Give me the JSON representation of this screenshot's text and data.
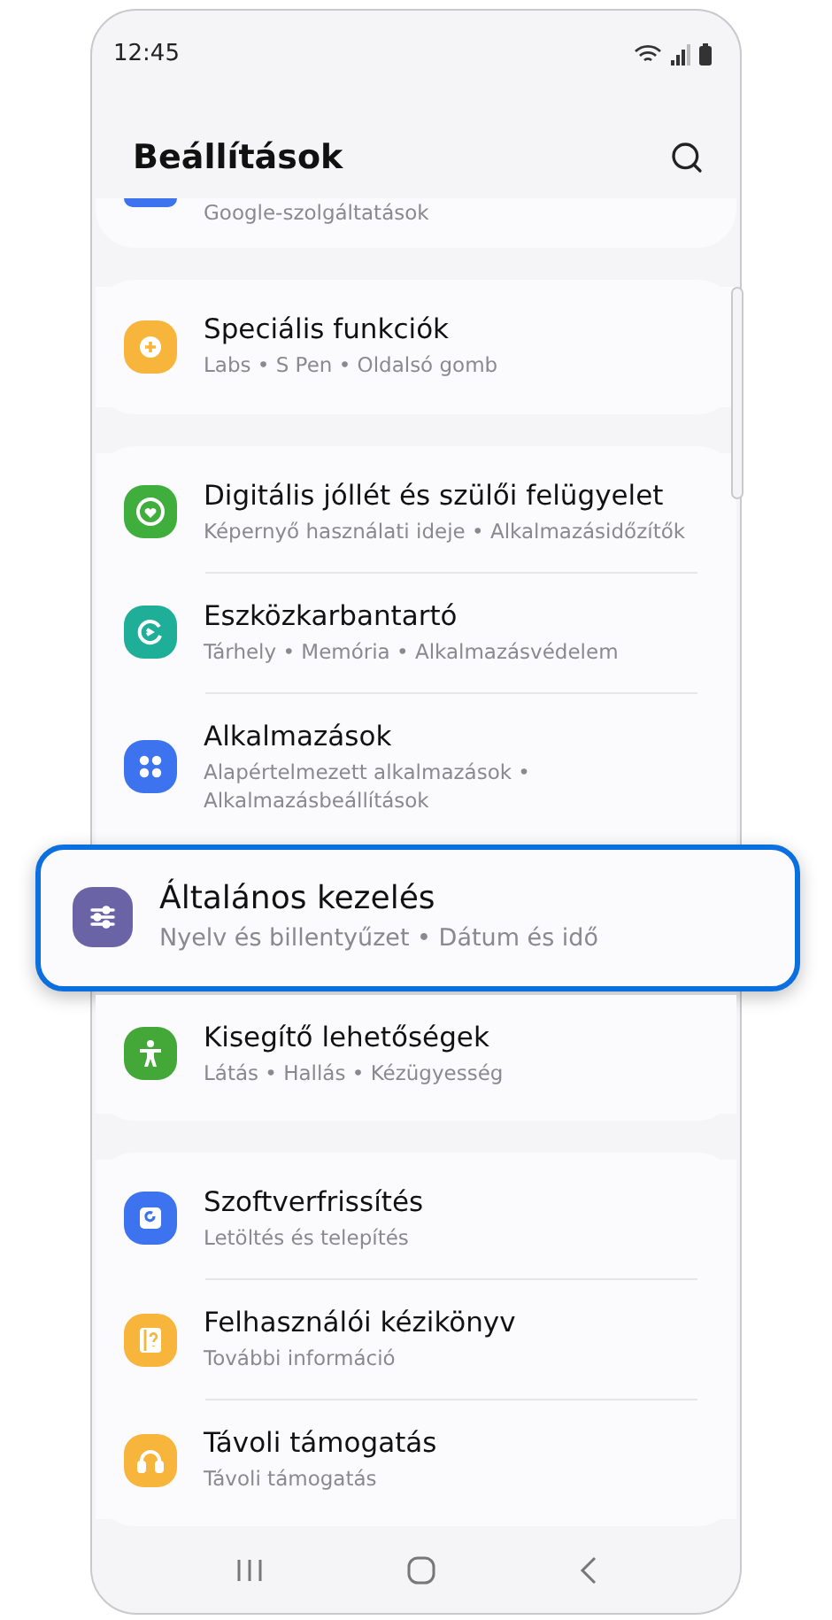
{
  "status_bar": {
    "time": "12:45"
  },
  "header": {
    "title": "Beállítások"
  },
  "groups": [
    {
      "partial": true,
      "items": [
        {
          "subtitle": "Google-szolgáltatások",
          "color": "#3d73ee"
        }
      ]
    },
    {
      "partial": false,
      "items": [
        {
          "title": "Speciális funkciók",
          "subtitle": "Labs  •  S Pen  •  Oldalsó gomb",
          "color": "#f8b53c"
        }
      ]
    },
    {
      "partial": false,
      "items": [
        {
          "title": "Digitális jóllét és szülői felügyelet",
          "subtitle": "Képernyő használati ideje  •  Alkalmazásidőzítők",
          "color": "#3fae3c"
        },
        {
          "title": "Eszközkarbantartó",
          "subtitle": "Tárhely  •  Memória  •  Alkalmazásvédelem",
          "color": "#1fae98"
        },
        {
          "title": "Alkalmazások",
          "subtitle": "Alapértelmezett alkalmazások  •  Alkalmazásbeállítások",
          "color": "#3d73ee"
        },
        {
          "title": "Általános kezelés",
          "subtitle": "Nyelv és billentyűzet  •  Dátum és idő",
          "color": "#6a64a6",
          "highlighted": true
        },
        {
          "title": "Kisegítő lehetőségek",
          "subtitle": "Látás  •  Hallás  •  Kézügyesség",
          "color": "#43a838"
        }
      ]
    },
    {
      "partial": false,
      "items": [
        {
          "title": "Szoftverfrissítés",
          "subtitle": "Letöltés és telepítés",
          "color": "#3d73ee"
        },
        {
          "title": "Felhasználói kézikönyv",
          "subtitle": "További információ",
          "color": "#f8b53c"
        },
        {
          "title": "Távoli támogatás",
          "subtitle": "Távoli támogatás",
          "color": "#f8b53c"
        }
      ]
    }
  ]
}
